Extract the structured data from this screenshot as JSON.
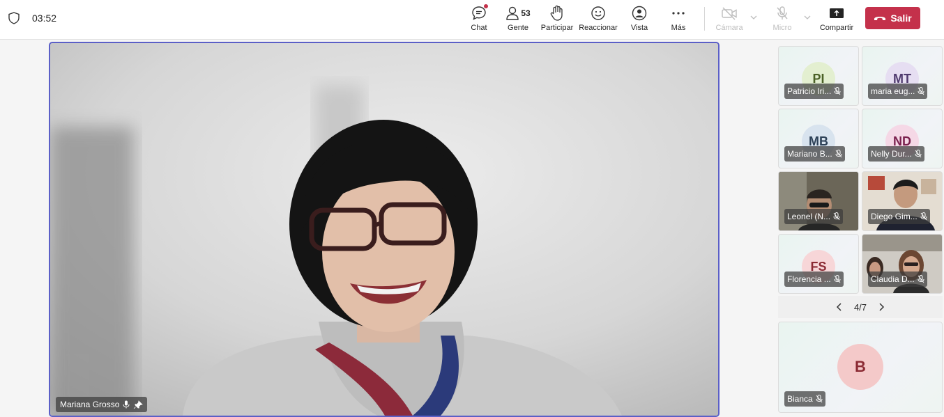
{
  "meeting": {
    "timer": "03:52"
  },
  "toolbar": {
    "chat": "Chat",
    "people": "Gente",
    "people_count": "53",
    "raise": "Participar",
    "react": "Reaccionar",
    "view": "Vista",
    "more": "Más",
    "camera": "Cámara",
    "mic": "Micro",
    "share": "Compartir",
    "leave": "Salir",
    "leave_color": "#c4314b",
    "accent_color": "#5b5fc7"
  },
  "main_speaker": {
    "name": "Mariana Grosso"
  },
  "participants": [
    {
      "initials": "PI",
      "name": "Patricio Iri...",
      "avatar_bg": "#e3efd0",
      "avatar_fg": "#4b6126"
    },
    {
      "initials": "MT",
      "name": "maria eug...",
      "avatar_bg": "#e6def2",
      "avatar_fg": "#4f3a6e"
    },
    {
      "initials": "MB",
      "name": "Mariano B...",
      "avatar_bg": "#d8e3ee",
      "avatar_fg": "#2d4157"
    },
    {
      "initials": "ND",
      "name": "Nelly Dur...",
      "avatar_bg": "#f5d8e6",
      "avatar_fg": "#7a1f4d"
    },
    {
      "initials": "",
      "name": "Leonel (N...",
      "video": true
    },
    {
      "initials": "",
      "name": "Diego Gim...",
      "video": true
    },
    {
      "initials": "FS",
      "name": "Florencia ...",
      "avatar_bg": "#f7d6d8",
      "avatar_fg": "#8b2b34"
    },
    {
      "initials": "",
      "name": "Claudia D...",
      "video": true
    }
  ],
  "pager": {
    "label": "4/7"
  },
  "bottom_tile": {
    "initials": "B",
    "name": "Bianca"
  }
}
